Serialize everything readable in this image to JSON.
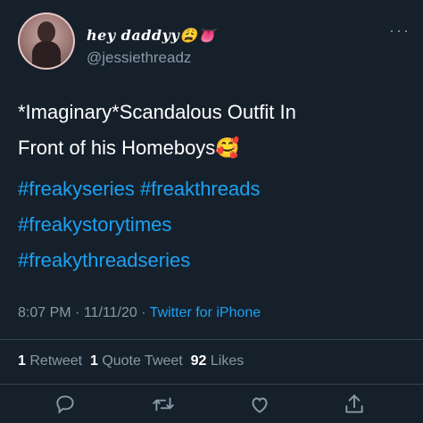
{
  "user": {
    "display_name": "hey daddyy😩👅",
    "username": "@jessiethreadz"
  },
  "tweet": {
    "text_line1": "*Imaginary*Scandalous Outfit In",
    "text_line2": "Front of his Homeboys🥰",
    "hashtags_row1": "#freakyseries #freakthreads",
    "hashtags_row2": "#freakystorytimes",
    "hashtags_row3": "#freakythreadseries",
    "time": "8:07 PM",
    "date": "11/11/20",
    "separator": "·",
    "source": "Twitter for iPhone"
  },
  "stats": {
    "retweets_count": "1",
    "retweets_label": "Retweet",
    "quotes_count": "1",
    "quotes_label": "Quote Tweet",
    "likes_count": "92",
    "likes_label": "Likes"
  },
  "more_menu": "···",
  "icons": [
    "avatar-image",
    "more-icon",
    "reply-icon",
    "retweet-icon",
    "like-icon",
    "share-icon"
  ],
  "colors": {
    "background": "#15202b",
    "accent": "#1da1f2",
    "secondary_text": "#8899a6",
    "divider": "#38444d"
  }
}
